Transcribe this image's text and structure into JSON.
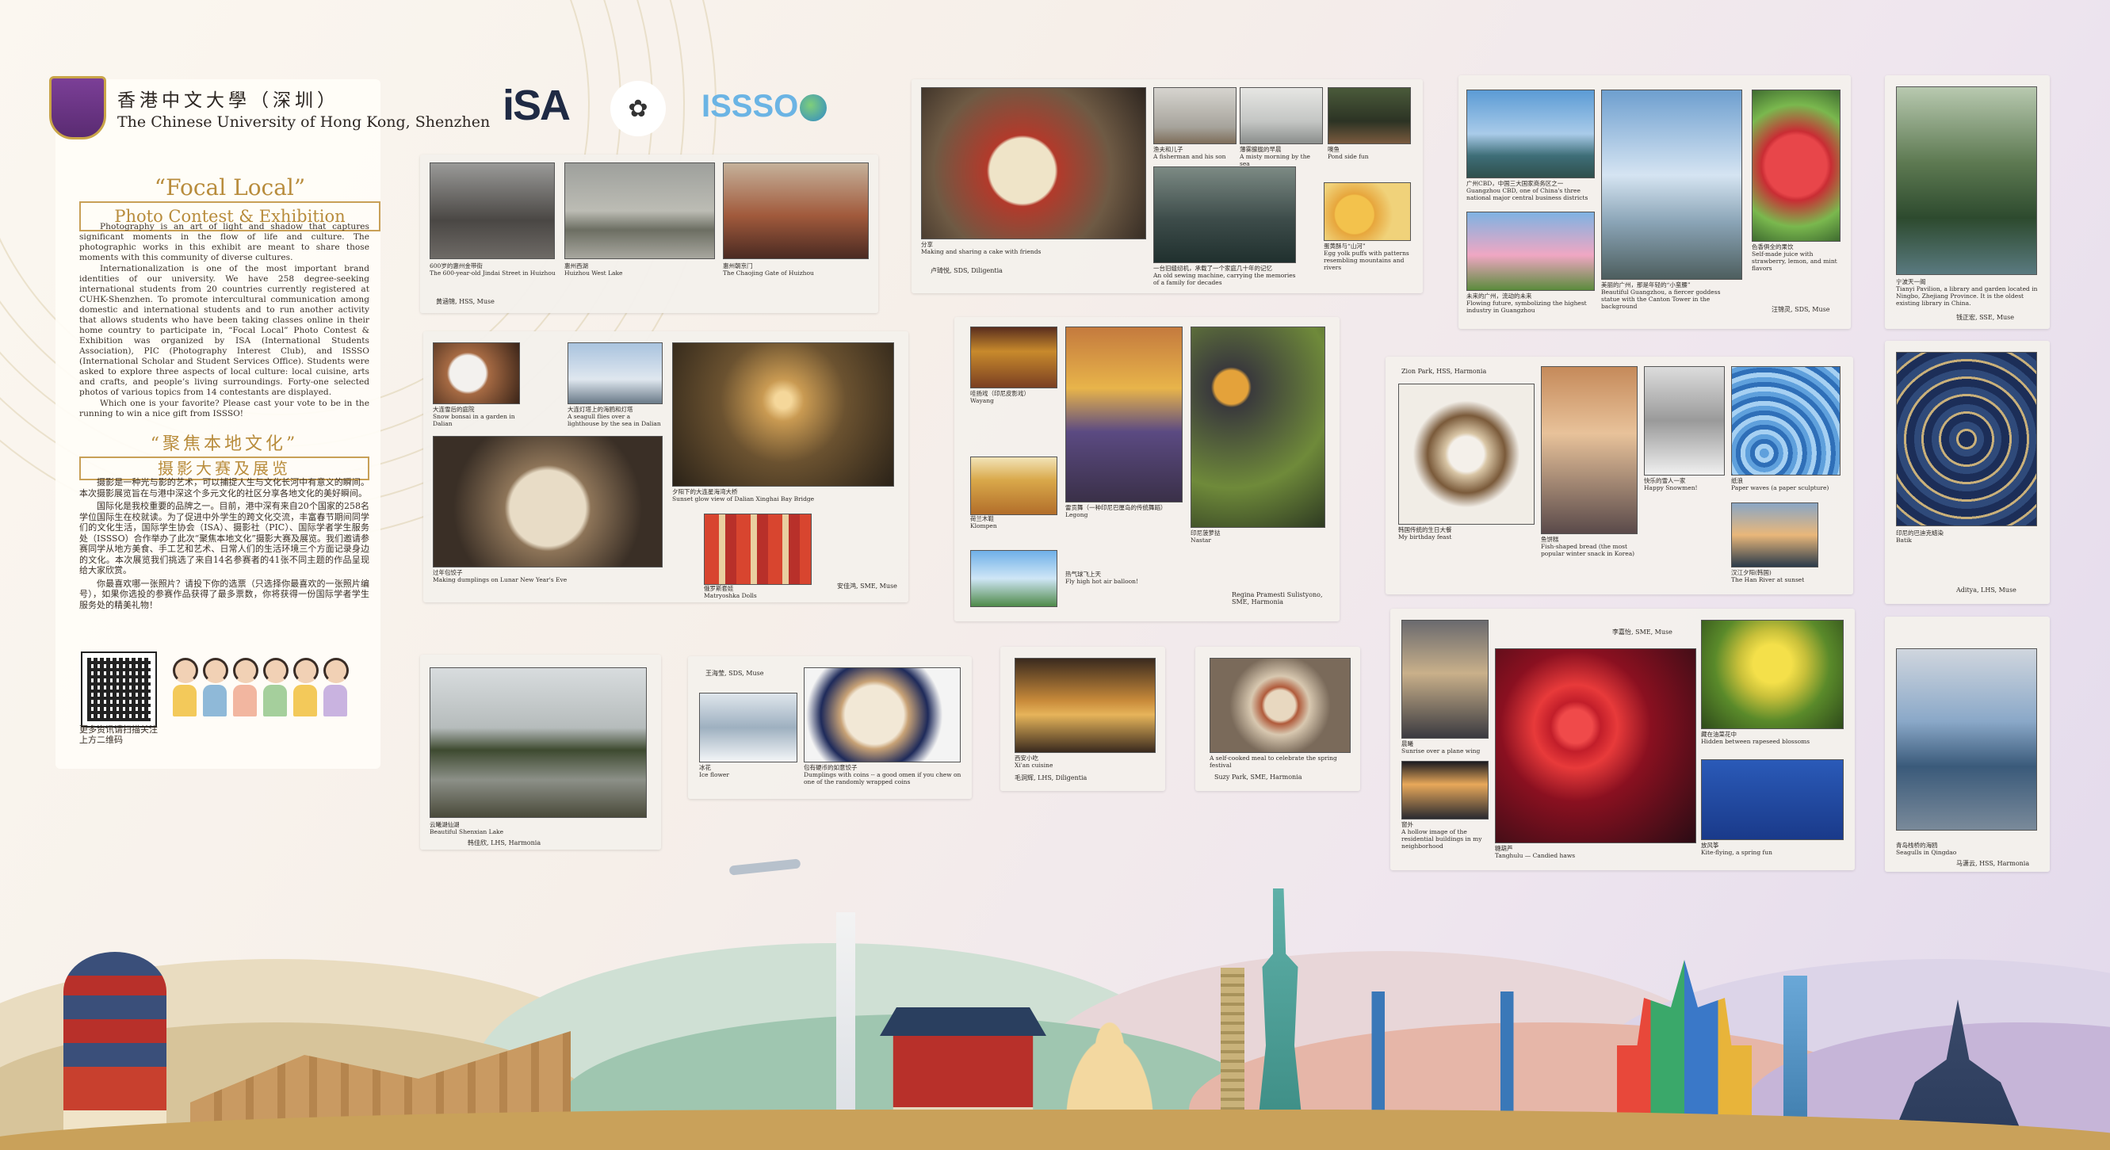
{
  "header": {
    "university_cn": "香港中文大學（深圳）",
    "university_en": "The Chinese University of Hong Kong, Shenzhen",
    "isa_logo": "iSA",
    "isso_logo": "ISSSO"
  },
  "intro": {
    "title_en": "“Focal Local”",
    "subtitle_en": "Photo Contest & Exhibition",
    "body_en": [
      "Photography is an art of light and shadow that captures significant moments in the flow of life and culture. The photographic works in this exhibit are meant to share those moments with this community of diverse cultures.",
      "Internationalization is one of the most important brand identities of our university. We have 258 degree-seeking international students from 20 countries currently registered at CUHK-Shenzhen. To promote intercultural communication among domestic and international students and to run another activity that allows students who have been taking classes online in their home country to participate in, “Focal Local” Photo Contest & Exhibition was organized by ISA (International Students Association), PIC (Photography Interest Club), and ISSSO (International Scholar and Student Services Office). Students were asked to explore three aspects of local culture: local cuisine, arts and crafts, and people’s living surroundings. Forty-one selected photos of various topics from 14 contestants are displayed.",
      "Which one is your favorite? Please cast your vote to be in the running to win a nice gift from ISSSO!"
    ],
    "title_cn": "“聚焦本地文化”",
    "subtitle_cn": "摄影大赛及展览",
    "body_cn": [
      "摄影是一种光与影的艺术，可以捕捉人生与文化长河中有意义的瞬间。本次摄影展览旨在与港中深这个多元文化的社区分享各地文化的美好瞬间。",
      "国际化是我校重要的品牌之一。目前，港中深有来自20个国家的258名学位国际生在校就读。为了促进中外学生的跨文化交流，丰富春节期间同学们的文化生活，国际学生协会（ISA）、摄影社（PIC）、国际学者学生服务处（ISSSO）合作举办了此次“聚焦本地文化”摄影大赛及展览。我们邀请参赛同学从地方美食、手工艺和艺术、日常人们的生活环境三个方面记录身边的文化。本次展览我们挑选了来自14名参赛者的41张不同主题的作品呈现给大家欣赏。",
      "你最喜欢哪一张照片？请投下你的选票（只选择你最喜欢的一张照片编号），如果你选投的参赛作品获得了最多票数，你将获得一份国际学者学生服务处的精美礼物！"
    ],
    "qr_caption": "更多资讯请扫描关注上方二维码"
  },
  "cards": [
    {
      "credit": "黄涵锦, HSS, Muse",
      "photos": [
        {
          "caption": "600岁的惠州金带街",
          "caption_en": "The 600-year-old Jindai Street in Huizhou"
        },
        {
          "caption": "惠州西湖",
          "caption_en": "Huizhou West Lake"
        },
        {
          "caption": "惠州朝京门",
          "caption_en": "The Chaojing Gate of Huizhou"
        }
      ]
    },
    {
      "credit": "卢琦悦, SDS, Diligentia",
      "photos": [
        {
          "caption": "分享",
          "caption_en": "Making and sharing a cake with friends"
        },
        {
          "caption": "渔夫和儿子",
          "caption_en": "A fisherman and his son"
        },
        {
          "caption": "薄雾朦胧的早晨",
          "caption_en": "A misty morning by the sea"
        },
        {
          "caption": "噢鱼",
          "caption_en": "Pond side fun"
        },
        {
          "caption": "一台旧缝纫机，承载了一个家庭几十年的记忆",
          "caption_en": "An old sewing machine, carrying the memories of a family for decades"
        },
        {
          "caption": "蛋黄酥与“山河”",
          "caption_en": "Egg yolk puffs with patterns resembling mountains and rivers"
        }
      ]
    },
    {
      "credit": "汪锦灵, SDS, Muse",
      "photos": [
        {
          "caption": "广州CBD，中国三大国家商务区之一",
          "caption_en": "Guangzhou CBD, one of China's three national major central business districts"
        },
        {
          "caption": "美丽的广州，那是年轻的“小蛮腰”",
          "caption_en": "Beautiful Guangzhou, a fiercer goddess statue with the Canton Tower in the background"
        },
        {
          "caption": "色香俱全的果饮",
          "caption_en": "Self-made juice with strawberry, lemon, and mint flavors"
        },
        {
          "caption": "未来的广州，流动的未来",
          "caption_en": "Flowing future, symbolizing the highest industry in Guangzhou"
        }
      ]
    },
    {
      "credit": "钱正宏, SSE, Muse",
      "photos": [
        {
          "caption": "宁波天一阁",
          "caption_en": "Tianyi Pavilion, a library and garden located in Ningbo, Zhejiang Province. It is the oldest existing library in China."
        }
      ]
    },
    {
      "credit": "安佳鸿, SME, Muse",
      "photos": [
        {
          "caption": "大连雪后的庭院",
          "caption_en": "Snow bonsai in a garden in Dalian"
        },
        {
          "caption": "大连灯塔上的海鸥和灯塔",
          "caption_en": "A seagull flies over a lighthouse by the sea in Dalian"
        },
        {
          "caption": "夕阳下的大连星海湾大桥",
          "caption_en": "Sunset glow view of Dalian Xinghai Bay Bridge"
        },
        {
          "caption": "过年包饺子",
          "caption_en": "Making dumplings on Lunar New Year's Eve"
        },
        {
          "caption": "俄罗斯套娃",
          "caption_en": "Matryoshka Dolls"
        }
      ]
    },
    {
      "credit": "Regina Pramesti Sulistyono, SME, Harmonia",
      "photos": [
        {
          "caption": "哇扬戏（印尼皮影戏）",
          "caption_en": "Wayang"
        },
        {
          "caption": "雷贡舞（一种印尼巴厘岛的传统舞蹈）",
          "caption_en": "Legong"
        },
        {
          "caption": "印尼菠萝挞",
          "caption_en": "Nastar"
        },
        {
          "caption": "荷兰木鞋",
          "caption_en": "Klompen"
        },
        {
          "caption": "热气球飞上天",
          "caption_en": "Fly high hot air balloon!"
        }
      ]
    },
    {
      "credit": "Zion Park, HSS, Harmonia",
      "photos": [
        {
          "caption": "韩国传统的生日大餐",
          "caption_en": "My birthday feast"
        },
        {
          "caption": "鱼饼糕",
          "caption_en": "Fish-shaped bread (the most popular winter snack in Korea)"
        },
        {
          "caption": "快乐的雪人一家",
          "caption_en": "Happy Snowmen!"
        },
        {
          "caption": "纸浪",
          "caption_en": "Paper waves (a paper sculpture)"
        },
        {
          "caption": "汉江夕阳(韩国)",
          "caption_en": "The Han River at sunset"
        }
      ]
    },
    {
      "credit": "Aditya, LHS, Muse",
      "photos": [
        {
          "caption": "印尼的巴迪克蜡染",
          "caption_en": "Batik"
        }
      ]
    },
    {
      "credit": "韩佳欣, LHS, Harmonia",
      "photos": [
        {
          "caption": "云曦湖仙湖",
          "caption_en": "Beautiful Shenxian Lake"
        }
      ]
    },
    {
      "credit": "王海莹, SDS, Muse",
      "photos": [
        {
          "caption": "冰花",
          "caption_en": "Ice flower"
        },
        {
          "caption": "包有硬币的如意饺子",
          "caption_en": "Dumplings with coins -- a good omen if you chew on one of the randomly wrapped coins"
        }
      ]
    },
    {
      "credit": "毛洞辉, LHS, Diligentia",
      "photos": [
        {
          "caption": "西安小吃",
          "caption_en": "Xi'an cuisine"
        }
      ]
    },
    {
      "credit": "Suzy Park, SME, Harmonia",
      "photos": [
        {
          "caption": "",
          "caption_en": "A self-cooked meal to celebrate the spring festival"
        }
      ]
    },
    {
      "credit": "李嘉怡, SME, Muse",
      "photos": [
        {
          "caption": "晨曦",
          "caption_en": "Sunrise over a plane wing"
        },
        {
          "caption": "糖葫芦",
          "caption_en": "Tanghulu — Candied haws"
        },
        {
          "caption": "藏在油菜花中",
          "caption_en": "Hidden between rapeseed blossoms"
        },
        {
          "caption": "窗外",
          "caption_en": "A hollow image of the residential buildings in my neighborhood"
        },
        {
          "caption": "放风筝",
          "caption_en": "Kite-flying, a spring fun"
        }
      ]
    },
    {
      "credit": "马潇云, HSS, Harmonia",
      "photos": [
        {
          "caption": "青岛栈桥的海鸥",
          "caption_en": "Seagulls in Qingdao"
        }
      ]
    }
  ],
  "colors": {
    "gold": "#b88c3c",
    "card": "#f3f0ec"
  }
}
